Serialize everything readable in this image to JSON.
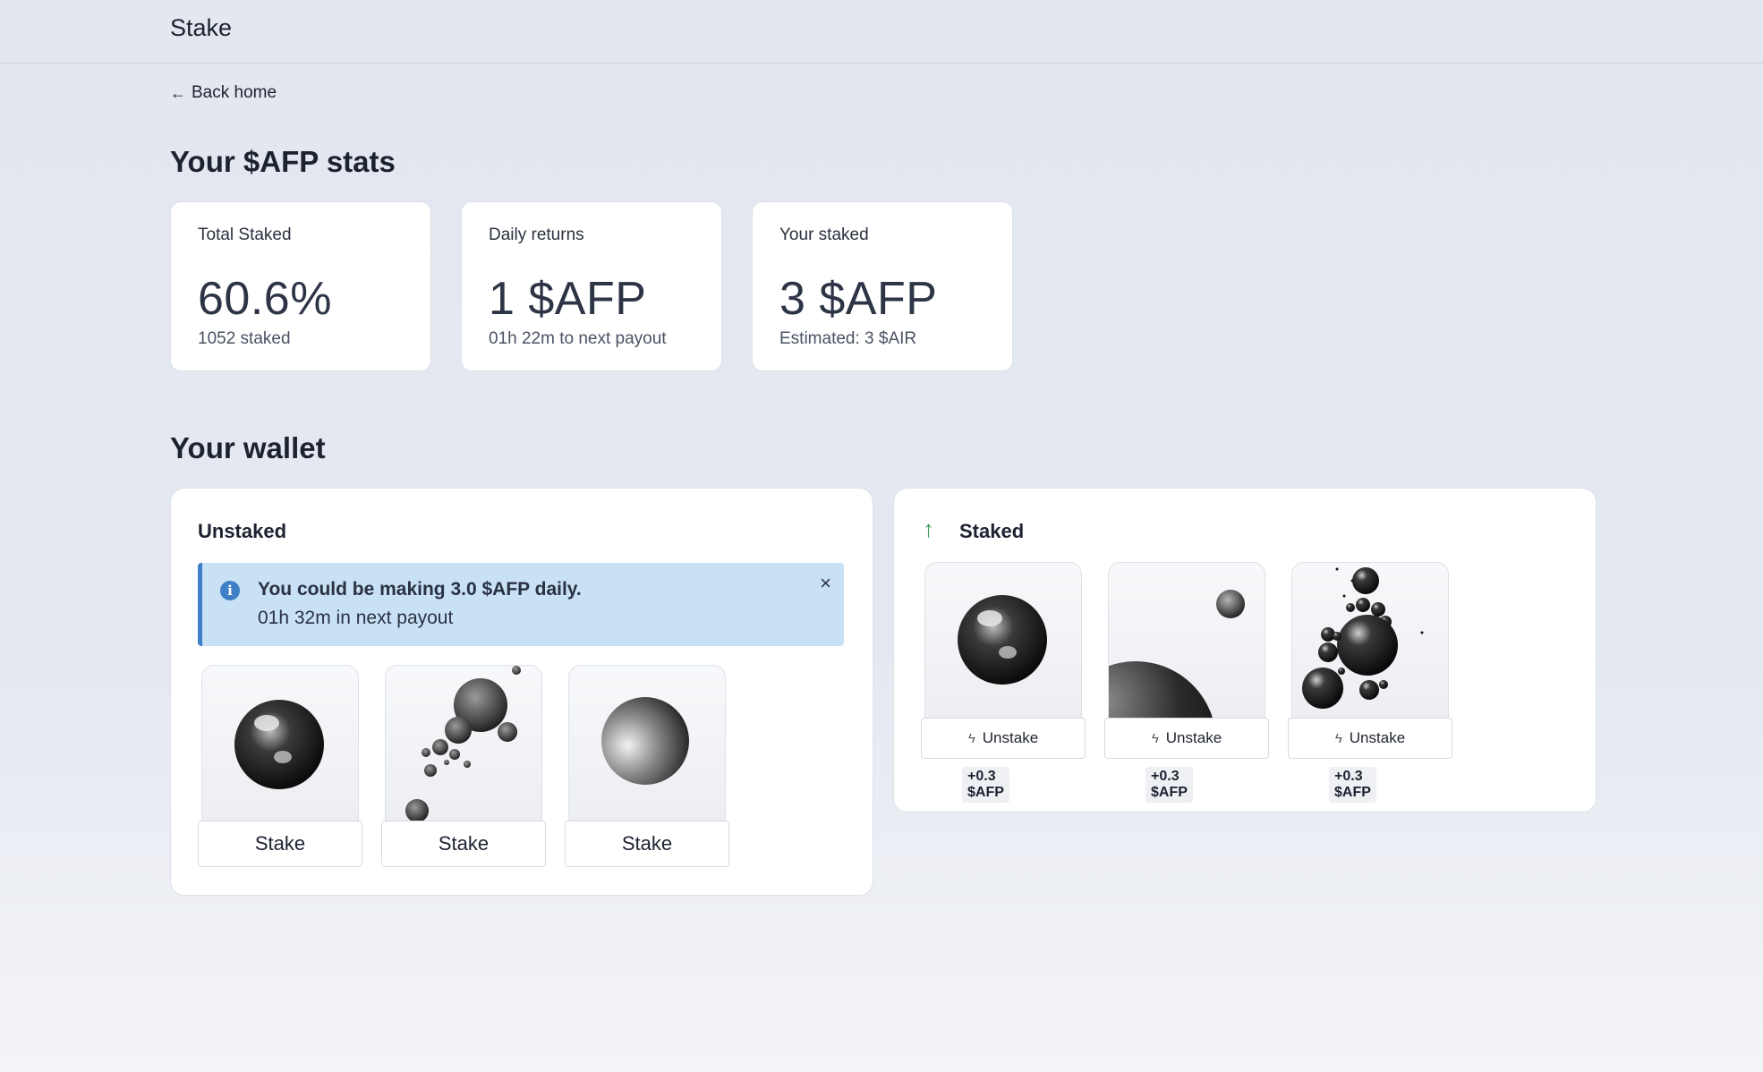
{
  "header": {
    "title": "Stake"
  },
  "nav": {
    "back_label": "Back home"
  },
  "stats": {
    "heading": "Your $AFP stats",
    "cards": [
      {
        "label": "Total Staked",
        "value": "60.6%",
        "sub": "1052 staked"
      },
      {
        "label": "Daily returns",
        "value": "1 $AFP",
        "sub": "01h 22m to next payout"
      },
      {
        "label": "Your staked",
        "value": "3 $AFP",
        "sub": "Estimated: 3 $AIR"
      }
    ]
  },
  "wallet": {
    "heading": "Your wallet",
    "unstaked": {
      "title": "Unstaked",
      "alert": {
        "message": "You could be making 3.0 $AFP daily.",
        "sub": "01h 32m in next payout",
        "close": "×"
      },
      "items": [
        {
          "image": "glossy-sphere",
          "button_label": "Stake"
        },
        {
          "image": "floating-spheres",
          "button_label": "Stake"
        },
        {
          "image": "matte-sphere",
          "button_label": "Stake"
        }
      ]
    },
    "staked": {
      "title": "Staked",
      "icon": "arrow-up-icon",
      "items": [
        {
          "image": "glossy-sphere",
          "button_label": "Unstake",
          "reward": "+0.3 $AFP"
        },
        {
          "image": "large-sphere-corner",
          "button_label": "Unstake",
          "reward": "+0.3 $AFP"
        },
        {
          "image": "sphere-cluster",
          "button_label": "Unstake",
          "reward": "+0.3 $AFP"
        }
      ]
    }
  },
  "colors": {
    "accent_blue": "#3f7fc7",
    "alert_bg": "#c8e1f5",
    "staked_green": "#3b9a5e"
  }
}
